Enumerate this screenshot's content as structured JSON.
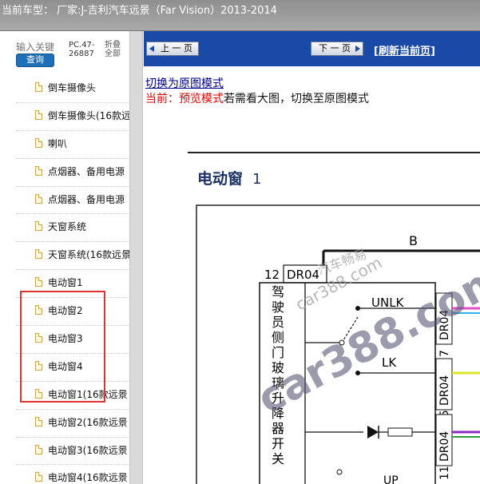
{
  "topbar": {
    "title": "当前车型：  厂家:J-吉利汽车远景（Far Vision）2013-2014"
  },
  "search": {
    "placeholder": "输入关键",
    "button_label": "查询"
  },
  "code_label": "PC.47-26887",
  "fold_label": "折叠 全部",
  "tree": {
    "items": [
      "倒车摄像头",
      "倒车摄像头(16款远",
      "喇叭",
      "点烟器、备用电源",
      "点烟器、备用电源",
      "天窗系统",
      "天窗系统(16款远景",
      "电动窗1",
      "电动窗2",
      "电动窗3",
      "电动窗4",
      "电动窗1(16款远景",
      "电动窗2(16款远景",
      "电动窗3(16款远景",
      "电动窗4(16款远景"
    ]
  },
  "nav": {
    "prev_label": "上 一 页",
    "next_label": "下 一 页",
    "refresh_label": "[刷新当前页]"
  },
  "content": {
    "switch_link": "切换为原图模式",
    "mode_prefix": "当前：预览模式",
    "mode_suffix": "若需看大图，切换至原图模式"
  },
  "diagram": {
    "title_text": "电动窗",
    "title_num": "1",
    "top_label": "B",
    "pin_12": "12",
    "conn_dr04": "DR04",
    "vertical_label": [
      "驾",
      "驶",
      "员",
      "侧",
      "门",
      "玻",
      "璃",
      "升",
      "降",
      "器",
      "开",
      "关"
    ],
    "switch_unlk": "UNLK",
    "switch_lk": "LK",
    "switch_up": "UP",
    "right_pins": [
      {
        "num": "7",
        "conn": "DR04"
      },
      {
        "num": "15",
        "conn": "DR04"
      },
      {
        "num": "11",
        "conn": "DR04"
      }
    ],
    "watermark_big": "car388.com",
    "watermark_small": "car388.com",
    "watermark_cn": "汽车畅易"
  },
  "colors": {
    "nav_bg": "#1a4aa8",
    "highlight": "#e0332f",
    "topbar": "#9a9a9a"
  }
}
